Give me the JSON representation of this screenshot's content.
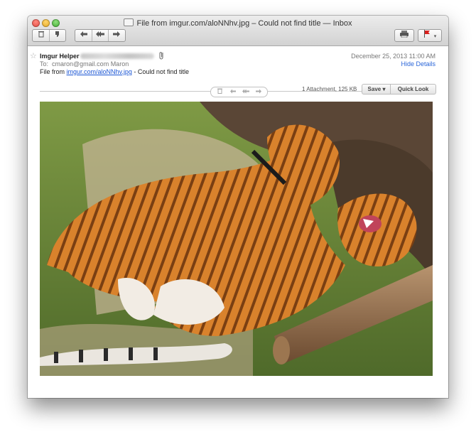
{
  "window": {
    "title": "File from imgur.com/aloNNhv.jpg – Could not find title — Inbox"
  },
  "toolbar": {
    "delete_icon": "trash-icon",
    "junk_icon": "thumbs-down-icon",
    "reply_icon": "reply-arrow-icon",
    "reply_all_icon": "reply-all-icon",
    "forward_icon": "forward-arrow-icon",
    "print_icon": "printer-icon",
    "flag_icon": "flag-icon",
    "flag_color": "#d8211f"
  },
  "message": {
    "sender_name": "Imgur Helper",
    "to_label": "To:",
    "to_value": "cmaron@gmail.com Maron",
    "subject_prefix": "File from",
    "subject_link": "imgur.com/aloNNhv.jpg",
    "subject_suffix": "- Could not find title",
    "date": "December 25, 2013  11:00 AM",
    "hide_details": "Hide Details",
    "attachment_info": "1 Attachment, 125 KB",
    "save_label": "Save ▾",
    "quick_look_label": "Quick Look"
  },
  "colors": {
    "link": "#1a55d4",
    "window_chrome": "#d6d6d6"
  }
}
